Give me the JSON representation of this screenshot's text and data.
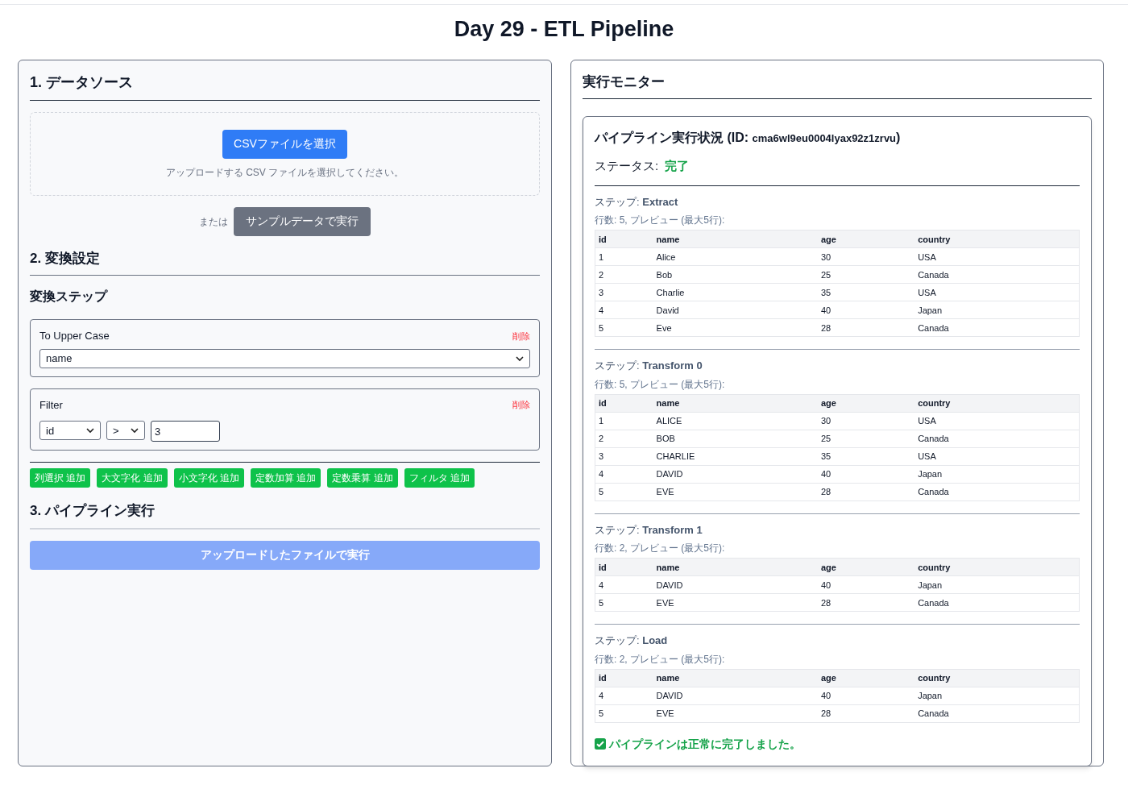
{
  "page_title": "Day 29 - ETL Pipeline",
  "left_panel": {
    "data_source": {
      "heading": "1. データソース",
      "upload_button": "CSVファイルを選択",
      "upload_hint": "アップロードする CSV ファイルを選択してください。",
      "or_label": "または",
      "sample_button": "サンプルデータで実行"
    },
    "transform": {
      "heading": "2. 変換設定",
      "subheading": "変換ステップ",
      "steps": [
        {
          "kind": "column_select",
          "title": "To Upper Case",
          "delete": "削除",
          "column": "name"
        },
        {
          "kind": "filter",
          "title": "Filter",
          "delete": "削除",
          "column": "id",
          "operator": ">",
          "value": "3"
        }
      ],
      "add_buttons": [
        "列選択 追加",
        "大文字化 追加",
        "小文字化 追加",
        "定数加算 追加",
        "定数乗算 追加",
        "フィルタ 追加"
      ]
    },
    "run": {
      "heading": "3. パイプライン実行",
      "button": "アップロードしたファイルで実行",
      "disabled": true
    }
  },
  "right_panel": {
    "heading": "実行モニター",
    "run": {
      "title": "パイプライン実行状況 (ID: ",
      "run_id": "cma6wl9eu0004lyax92z1zrvu",
      "title_end": ")",
      "status_label": "ステータス:",
      "status": "完了",
      "status_success": true,
      "steps": [
        {
          "title": "ステップ: **Extract**",
          "meta": "行数: 5, プレビュー (最大5行):",
          "columns": [
            "id",
            "name",
            "age",
            "country"
          ],
          "rows": [
            [
              "1",
              "Alice",
              "30",
              "USA"
            ],
            [
              "2",
              "Bob",
              "25",
              "Canada"
            ],
            [
              "3",
              "Charlie",
              "35",
              "USA"
            ],
            [
              "4",
              "David",
              "40",
              "Japan"
            ],
            [
              "5",
              "Eve",
              "28",
              "Canada"
            ]
          ]
        },
        {
          "title": "ステップ: **Transform 0**",
          "meta": "行数: 5, プレビュー (最大5行):",
          "columns": [
            "id",
            "name",
            "age",
            "country"
          ],
          "rows": [
            [
              "1",
              "ALICE",
              "30",
              "USA"
            ],
            [
              "2",
              "BOB",
              "25",
              "Canada"
            ],
            [
              "3",
              "CHARLIE",
              "35",
              "USA"
            ],
            [
              "4",
              "DAVID",
              "40",
              "Japan"
            ],
            [
              "5",
              "EVE",
              "28",
              "Canada"
            ]
          ]
        },
        {
          "title": "ステップ: **Transform 1**",
          "meta": "行数: 2, プレビュー (最大5行):",
          "columns": [
            "id",
            "name",
            "age",
            "country"
          ],
          "rows": [
            [
              "4",
              "DAVID",
              "40",
              "Japan"
            ],
            [
              "5",
              "EVE",
              "28",
              "Canada"
            ]
          ]
        },
        {
          "title": "ステップ: **Load**",
          "meta": "行数: 2, プレビュー (最大5行):",
          "columns": [
            "id",
            "name",
            "age",
            "country"
          ],
          "rows": [
            [
              "4",
              "DAVID",
              "40",
              "Japan"
            ],
            [
              "5",
              "EVE",
              "28",
              "Canada"
            ]
          ]
        }
      ],
      "result_message": "パイプラインは正常に完了しました。"
    }
  }
}
